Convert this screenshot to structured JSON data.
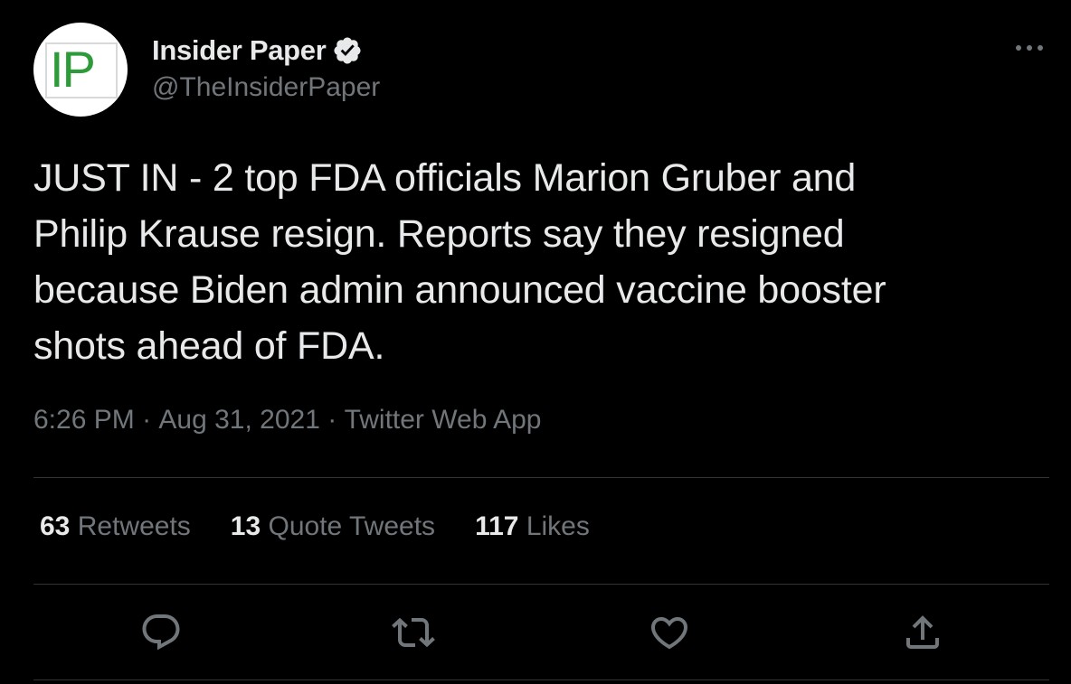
{
  "account": {
    "avatar_text": "IP",
    "display_name": "Insider Paper",
    "handle": "@TheInsiderPaper",
    "verified": true
  },
  "icons": {
    "avatar": "insider-paper-logo",
    "verified": "verified-badge-icon",
    "more": "more-options-icon",
    "reply": "reply-icon",
    "retweet": "retweet-icon",
    "like": "heart-icon",
    "share": "share-icon"
  },
  "tweet": {
    "text": "JUST IN - 2 top FDA officials Marion Gruber and\nPhilip Krause resign. Reports say they resigned\nbecause Biden admin announced vaccine booster\nshots ahead of FDA."
  },
  "meta": {
    "time": "6:26 PM",
    "separator": " · ",
    "date": "Aug 31, 2021",
    "source": "Twitter Web App"
  },
  "stats": {
    "retweets_count": "63",
    "retweets_label": "Retweets",
    "quotes_count": "13",
    "quotes_label": "Quote Tweets",
    "likes_count": "117",
    "likes_label": "Likes"
  },
  "colors": {
    "background": "#000000",
    "text_primary": "#e7e9ea",
    "text_secondary": "#71767b",
    "divider": "#2f3336",
    "logo_green": "#2e9b3a"
  }
}
